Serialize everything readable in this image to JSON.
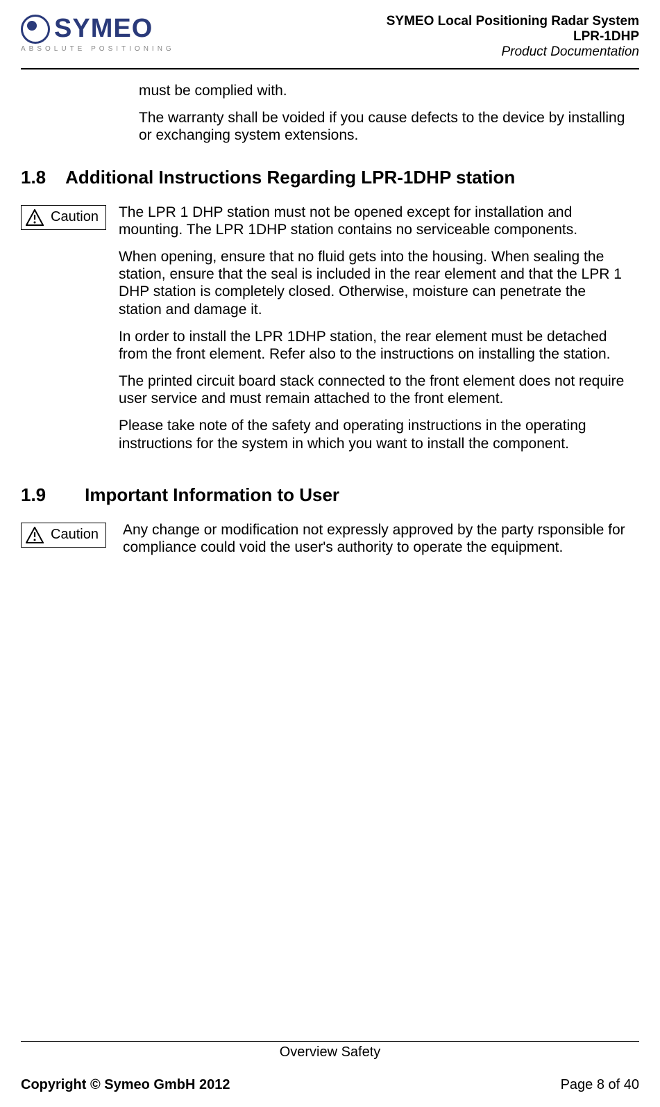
{
  "header": {
    "logo_text": "SYMEO",
    "tagline": "ABSOLUTE POSITIONING",
    "line1": "SYMEO Local Positioning Radar System",
    "line2": "LPR-1DHP",
    "line3": "Product Documentation"
  },
  "body": {
    "p1": "must be complied with.",
    "p2": "The warranty shall be voided if you cause defects to the device by installing or exchanging system extensions."
  },
  "section18": {
    "num": "1.8",
    "title": "Additional Instructions Regarding LPR-1DHP station",
    "caution_label": "Caution",
    "p1": "The LPR 1 DHP station must not be opened except for installation and mounting. The LPR 1DHP station contains no serviceable components.",
    "p2": "When opening, ensure that no fluid gets into the housing. When sealing the station, ensure that the seal is included in the rear element and that the LPR 1 DHP station is completely closed. Otherwise, moisture can penetrate the station and damage it.",
    "p3": "In order to install the LPR 1DHP station, the rear element must be detached from the front element. Refer also to the instructions on installing the station.",
    "p4": "The printed circuit board stack connected to the front element does not require user service and must remain attached to the front element.",
    "p5": "Please take note of the safety and operating instructions in the operating instructions for the system in which you want to install the component."
  },
  "section19": {
    "num": "1.9",
    "title": "Important Information to User",
    "caution_label": "Caution",
    "p1": "Any change or modification not expressly approved by the party rsponsible for compliance could void the user's authority to operate the equipment."
  },
  "footer": {
    "center": "Overview Safety",
    "left": "Copyright © Symeo GmbH 2012",
    "right": "Page 8 of 40"
  }
}
